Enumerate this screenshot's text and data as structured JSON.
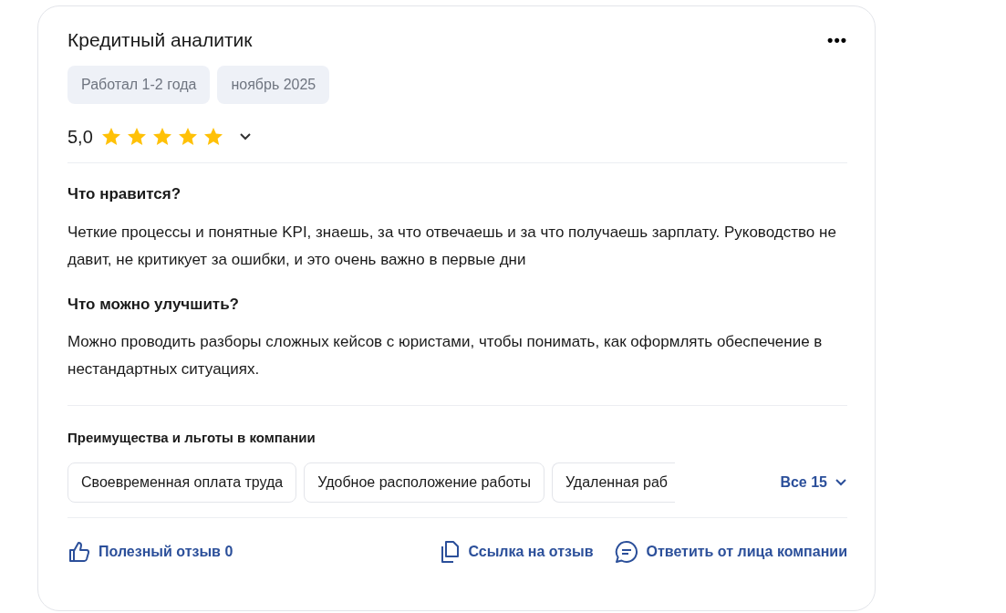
{
  "review": {
    "title": "Кредитный аналитик",
    "menu_icon": "•••",
    "tags": [
      "Работал 1-2 года",
      "ноябрь 2025"
    ],
    "rating": "5,0",
    "stars": 5,
    "sections": [
      {
        "heading": "Что нравится?",
        "text": "Четкие процессы и понятные KPI, знаешь, за что отвечаешь и за что получаешь зарплату. Руководство не давит, не критикует за ошибки, и это очень важно в первые дни"
      },
      {
        "heading": "Что можно улучшить?",
        "text": "Можно проводить разборы сложных кейсов с юристами, чтобы понимать, как оформлять обеспечение в нестандартных ситуациях."
      }
    ],
    "benefits_title": "Преимущества и льготы в компании",
    "benefits": [
      {
        "label": "Своевременная оплата труда",
        "cut": false
      },
      {
        "label": "Удобное расположение работы",
        "cut": false
      },
      {
        "label": "Удаленная раб",
        "cut": true
      }
    ],
    "benefits_more": "Все 15",
    "actions": [
      {
        "kind": "like",
        "label": "Полезный отзыв 0"
      },
      {
        "kind": "link",
        "label": "Ссылка на отзыв"
      },
      {
        "kind": "reply",
        "label": "Ответить от лица компании"
      }
    ]
  }
}
